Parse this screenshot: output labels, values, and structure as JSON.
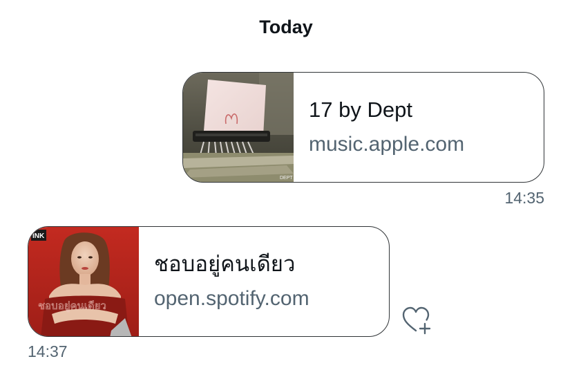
{
  "conversation": {
    "date_divider": "Today",
    "messages": [
      {
        "direction": "outgoing",
        "card": {
          "title": "17 by Dept",
          "domain": "music.apple.com",
          "thumbnail_icon": "album-art-paper-shredder-image",
          "thumbnail_caption": "DEPT"
        },
        "time": "14:35"
      },
      {
        "direction": "incoming",
        "card": {
          "title": "ชอบอยู่คนเดียว",
          "domain": "open.spotify.com",
          "thumbnail_icon": "album-art-portrait-image",
          "thumbnail_logo": "INK"
        },
        "time": "14:37",
        "reaction_icon": "heart-plus-icon"
      }
    ]
  },
  "colors": {
    "text_primary": "#0f1419",
    "text_secondary": "#536471",
    "card_border": "#2f3336",
    "album_red": "#b8241c"
  }
}
